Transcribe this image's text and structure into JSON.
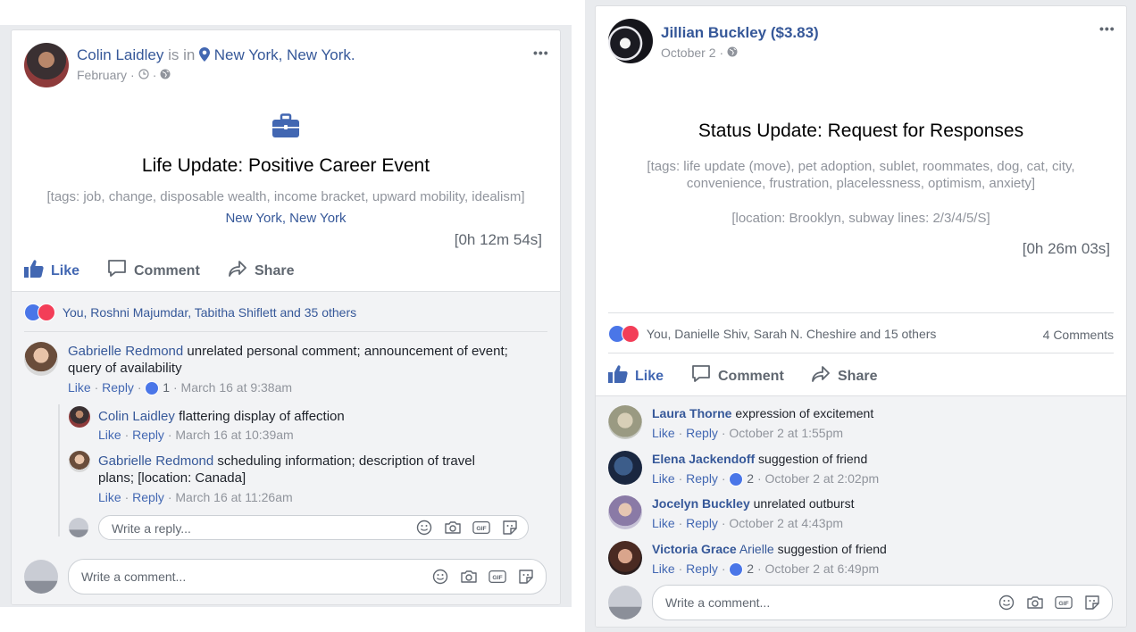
{
  "left_post": {
    "author": "Colin Laidley",
    "is_in_text": "is in",
    "location": "New York, New York.",
    "date": "February",
    "meta_sep": "·",
    "title": "Life Update: Positive Career Event",
    "tags": "[tags: job, change, disposable wealth, income bracket, upward mobility, idealism]",
    "place_link": "New York, New York",
    "duration": "[0h 12m 54s]",
    "actions": {
      "like": "Like",
      "comment": "Comment",
      "share": "Share"
    },
    "reactions_text": "You, Roshni Majumdar, Tabitha Shiflett and 35 others",
    "comments": [
      {
        "name": "Gabrielle Redmond",
        "text": "unrelated personal comment; announcement of event;",
        "text2": "query of availability",
        "like": "Like",
        "reply": "Reply",
        "count": "1",
        "time": "March 16 at 9:38am"
      }
    ],
    "replies": [
      {
        "name": "Colin Laidley",
        "text": "flattering display of affection",
        "like": "Like",
        "reply": "Reply",
        "time": "March 16 at 10:39am"
      },
      {
        "name": "Gabrielle Redmond",
        "text": "scheduling information; description of travel",
        "text2": "plans; [location: Canada]",
        "like": "Like",
        "reply": "Reply",
        "time": "March 16 at 11:26am"
      }
    ],
    "reply_placeholder": "Write a reply...",
    "comment_placeholder": "Write a comment..."
  },
  "right_post": {
    "author": "Jillian Buckley ($3.83)",
    "date": "October 2",
    "meta_sep": "·",
    "title": "Status Update: Request for Responses",
    "tags_line1": "[tags: life update (move), pet adoption, sublet, roommates, dog, cat, city,",
    "tags_line2": "convenience, frustration, placelessness, optimism, anxiety]",
    "location_line": "[location: Brooklyn, subway lines: 2/3/4/5/S]",
    "duration": "[0h 26m 03s]",
    "reactions_text": "You, Danielle Shiv, Sarah N. Cheshire and 15 others",
    "comments_count": "4 Comments",
    "actions": {
      "like": "Like",
      "comment": "Comment",
      "share": "Share"
    },
    "comments": [
      {
        "name": "Laura Thorne",
        "text": "expression of excitement",
        "like": "Like",
        "reply": "Reply",
        "count": "",
        "time": "October 2 at 1:55pm"
      },
      {
        "name": "Elena Jackendoff",
        "text": "suggestion of friend",
        "like": "Like",
        "reply": "Reply",
        "count": "2",
        "time": "October 2 at 2:02pm"
      },
      {
        "name": "Jocelyn Buckley",
        "text": "unrelated outburst",
        "like": "Like",
        "reply": "Reply",
        "count": "",
        "time": "October 2 at 4:43pm"
      },
      {
        "name_bold": "Victoria Grace",
        "name_rest": "Arielle",
        "text": "suggestion of friend",
        "like": "Like",
        "reply": "Reply",
        "count": "2",
        "time": "October 2 at 6:49pm"
      }
    ],
    "comment_placeholder": "Write a comment..."
  },
  "colors": {
    "link": "#365899",
    "like_blue": "#4267b2",
    "love_red": "#f33e58",
    "grey_bg": "#f2f3f5"
  },
  "icons": [
    "more-icon",
    "location-pin-icon",
    "clock-icon",
    "globe-icon",
    "briefcase-icon",
    "thumb-up-icon",
    "comment-icon",
    "share-icon",
    "smiley-icon",
    "camera-icon",
    "gif-icon",
    "sticker-icon"
  ]
}
